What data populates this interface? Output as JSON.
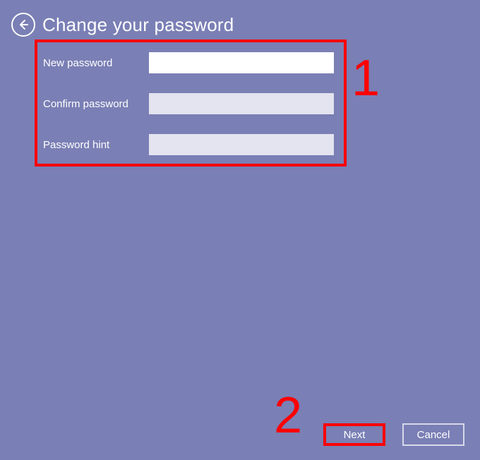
{
  "header": {
    "title": "Change your password"
  },
  "form": {
    "new_password": {
      "label": "New password",
      "value": ""
    },
    "confirm_password": {
      "label": "Confirm password",
      "value": ""
    },
    "password_hint": {
      "label": "Password hint",
      "value": ""
    }
  },
  "buttons": {
    "next": "Next",
    "cancel": "Cancel"
  },
  "annotations": {
    "step1": "1",
    "step2": "2"
  },
  "colors": {
    "background": "#7a7fb5",
    "highlight": "#ff0000",
    "input_bg": "#e3e4ef",
    "input_focus_bg": "#ffffff",
    "text": "#ffffff"
  }
}
